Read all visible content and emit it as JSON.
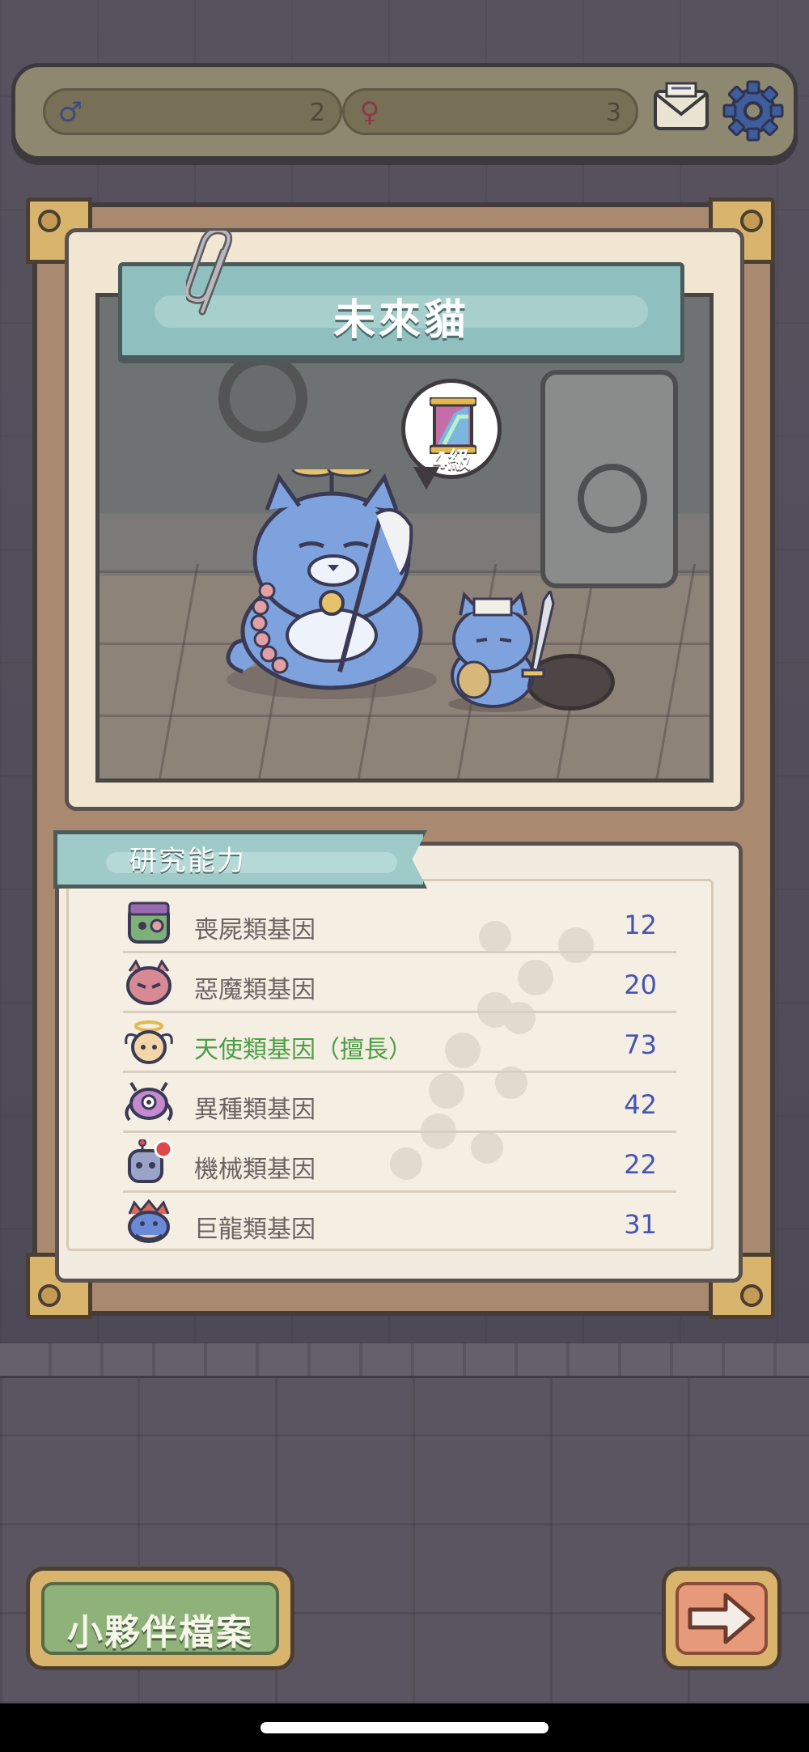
{
  "resources": [
    {
      "icon": "male-symbol-icon",
      "value": "2"
    },
    {
      "icon": "female-symbol-icon",
      "value": "3"
    }
  ],
  "card": {
    "title": "未來貓",
    "level_label": "4級"
  },
  "research": {
    "header": "研究能力",
    "genes": [
      {
        "icon": "zombie-icon",
        "label": "喪屍類基因",
        "value": "12",
        "specialty": false
      },
      {
        "icon": "demon-icon",
        "label": "惡魔類基因",
        "value": "20",
        "specialty": false
      },
      {
        "icon": "angel-icon",
        "label": "天使類基因（擅長）",
        "value": "73",
        "specialty": true
      },
      {
        "icon": "alien-icon",
        "label": "異種類基因",
        "value": "42",
        "specialty": false
      },
      {
        "icon": "robot-icon",
        "label": "機械類基因",
        "value": "22",
        "specialty": false
      },
      {
        "icon": "dragon-icon",
        "label": "巨龍類基因",
        "value": "31",
        "specialty": false
      }
    ]
  },
  "buttons": {
    "profile_label": "小夥伴檔案",
    "next_icon": "arrow-right-icon"
  },
  "colors": {
    "specialty_text": "#4c9e46",
    "value_text": "#4454b4",
    "banner": "#8fc0bf"
  }
}
